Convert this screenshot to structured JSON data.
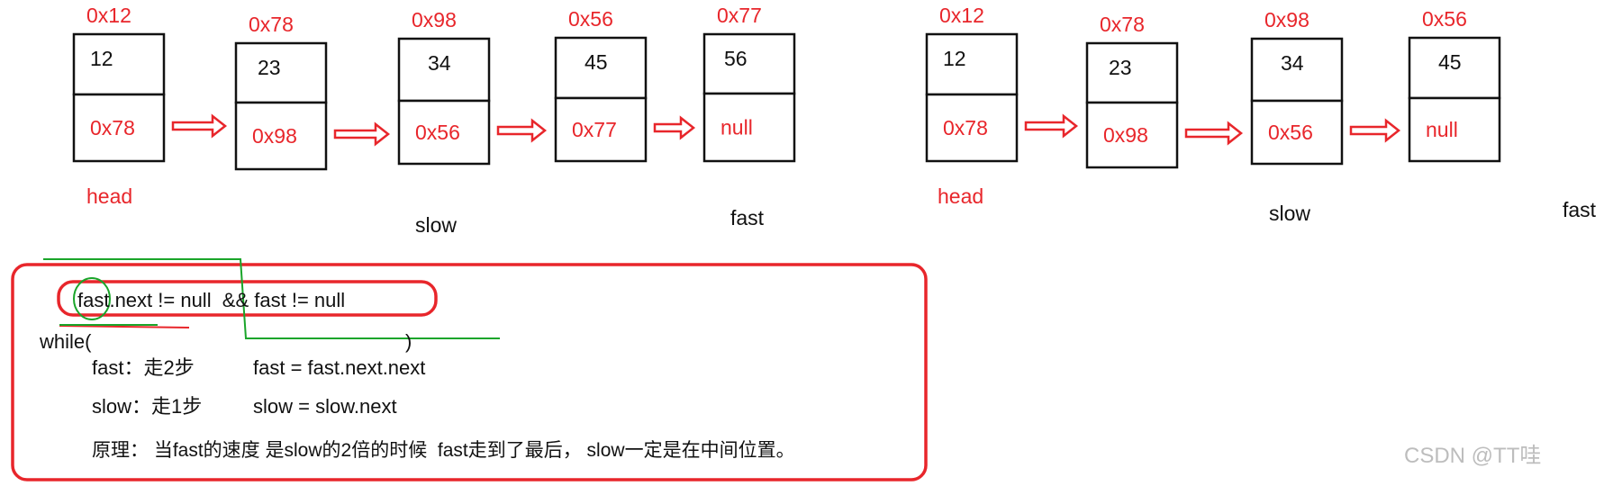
{
  "diagram_left": {
    "nodes": [
      {
        "address": "0x12",
        "value": "12",
        "next": "0x78"
      },
      {
        "address": "0x78",
        "value": "23",
        "next": "0x98"
      },
      {
        "address": "0x98",
        "value": "34",
        "next": "0x56"
      },
      {
        "address": "0x56",
        "value": "45",
        "next": "0x77"
      },
      {
        "address": "0x77",
        "value": "56",
        "next": "null"
      }
    ],
    "head_label": "head",
    "slow_label": "slow",
    "fast_label": "fast"
  },
  "diagram_right": {
    "nodes": [
      {
        "address": "0x12",
        "value": "12",
        "next": "0x78"
      },
      {
        "address": "0x78",
        "value": "23",
        "next": "0x98"
      },
      {
        "address": "0x98",
        "value": "34",
        "next": "0x56"
      },
      {
        "address": "0x56",
        "value": "45",
        "next": "null"
      }
    ],
    "head_label": "head",
    "slow_label": "slow",
    "fast_label": "fast"
  },
  "code": {
    "condition": "fast.next != null  && fast != null",
    "while_open": "while(",
    "while_close": ")",
    "fast_rule": "fast：走2步",
    "fast_code": "fast = fast.next.next",
    "slow_rule": "slow：走1步",
    "slow_code": "slow = slow.next",
    "principle": "原理： 当fast的速度 是slow的2倍的时候  fast走到了最后， slow一定是在中间位置。"
  },
  "watermark": "CSDN @TT哇",
  "colors": {
    "accent": "#e8262b",
    "annotation": "#1aa52a",
    "text": "#111111"
  }
}
